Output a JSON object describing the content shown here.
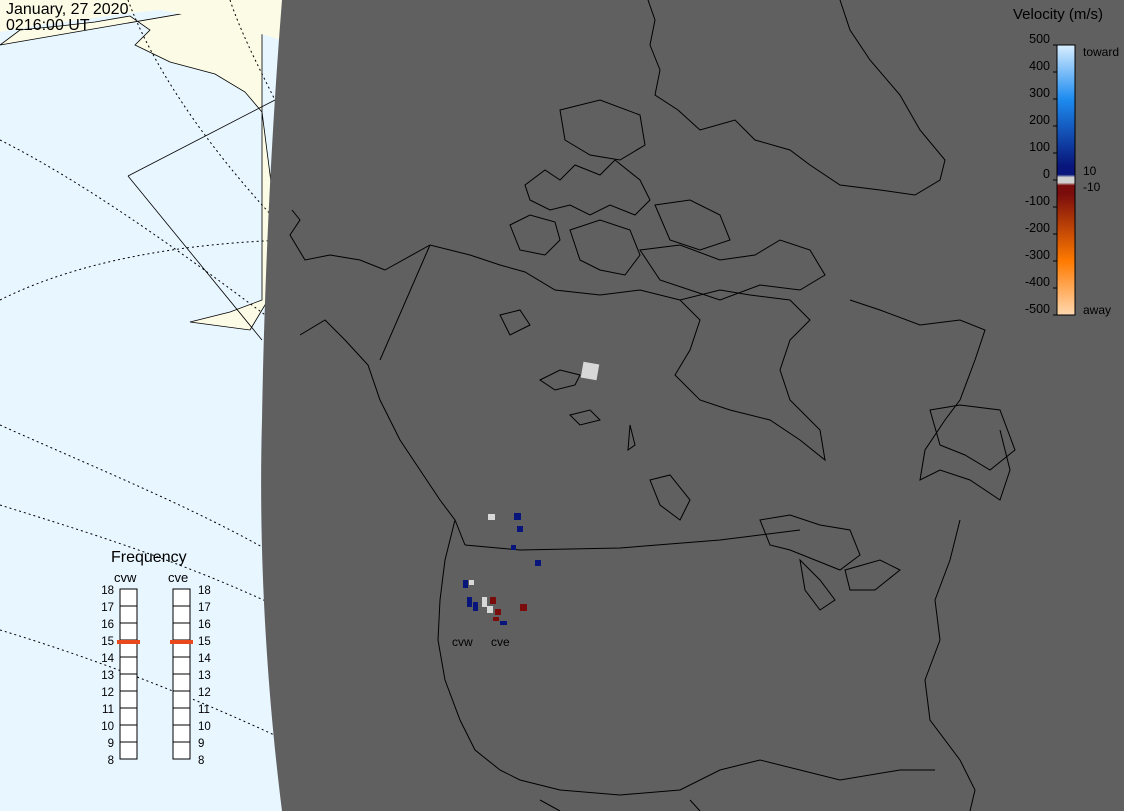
{
  "header": {
    "date": "January, 27 2020",
    "time": "0216:00 UT"
  },
  "legend": {
    "title": "Velocity (m/s)",
    "ticks": [
      "500",
      "400",
      "300",
      "200",
      "100",
      "0",
      "-100",
      "-200",
      "-300",
      "-400",
      "-500"
    ],
    "inner_ticks": [
      "10",
      "-10"
    ],
    "toward_label": "toward",
    "away_label": "away",
    "colors": {
      "toward_top": "#d8eeff",
      "toward_mid": "#1e8cf0",
      "toward_low": "#08157a",
      "zero_band": "#d0d0d0",
      "away_low": "#7a0c0c",
      "away_mid": "#ff7a00",
      "away_top": "#ffd9b0"
    }
  },
  "frequency_panel": {
    "title": "Frequency",
    "radars": [
      {
        "name": "cvw",
        "frequency_mhz": 15
      },
      {
        "name": "cve",
        "frequency_mhz": 15
      }
    ],
    "scale": [
      "18",
      "17",
      "16",
      "15",
      "14",
      "13",
      "12",
      "11",
      "10",
      "9",
      "8"
    ],
    "indicator_color": "#e8481c"
  },
  "map": {
    "ocean_color": "#e8f6ff",
    "land_color": "#fcfbe6",
    "night_color": "#606060",
    "site_labels": [
      "cvw",
      "cve"
    ]
  }
}
